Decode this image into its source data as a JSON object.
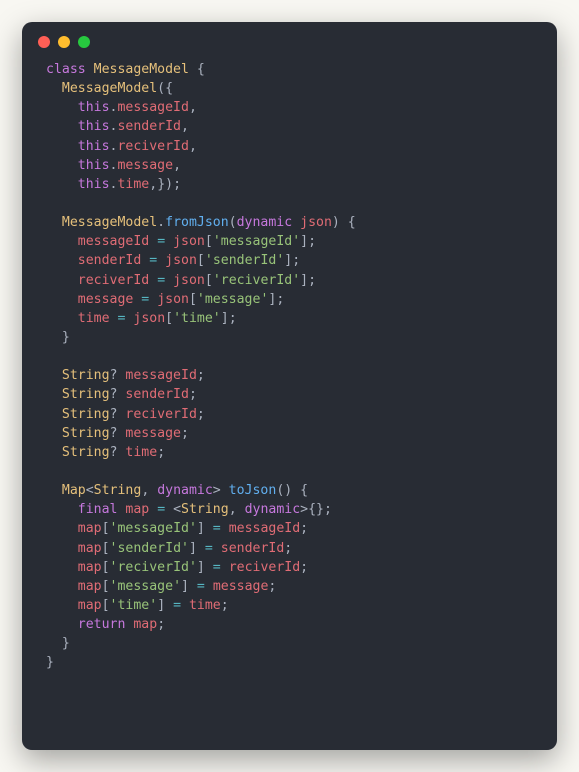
{
  "window": {
    "buttons": [
      "close",
      "minimize",
      "maximize"
    ]
  },
  "code": {
    "lines": [
      [
        [
          "kw",
          "class "
        ],
        [
          "type",
          "MessageModel"
        ],
        [
          "punc",
          " {"
        ]
      ],
      [
        [
          "punc",
          "  "
        ],
        [
          "type",
          "MessageModel"
        ],
        [
          "punc",
          "({"
        ]
      ],
      [
        [
          "punc",
          "    "
        ],
        [
          "kw",
          "this"
        ],
        [
          "punc",
          "."
        ],
        [
          "id",
          "messageId"
        ],
        [
          "punc",
          ","
        ]
      ],
      [
        [
          "punc",
          "    "
        ],
        [
          "kw",
          "this"
        ],
        [
          "punc",
          "."
        ],
        [
          "id",
          "senderId"
        ],
        [
          "punc",
          ","
        ]
      ],
      [
        [
          "punc",
          "    "
        ],
        [
          "kw",
          "this"
        ],
        [
          "punc",
          "."
        ],
        [
          "id",
          "reciverId"
        ],
        [
          "punc",
          ","
        ]
      ],
      [
        [
          "punc",
          "    "
        ],
        [
          "kw",
          "this"
        ],
        [
          "punc",
          "."
        ],
        [
          "id",
          "message"
        ],
        [
          "punc",
          ","
        ]
      ],
      [
        [
          "punc",
          "    "
        ],
        [
          "kw",
          "this"
        ],
        [
          "punc",
          "."
        ],
        [
          "id",
          "time"
        ],
        [
          "punc",
          ",});"
        ]
      ],
      [
        [
          "punc",
          ""
        ]
      ],
      [
        [
          "punc",
          "  "
        ],
        [
          "type",
          "MessageModel"
        ],
        [
          "punc",
          "."
        ],
        [
          "fn",
          "fromJson"
        ],
        [
          "punc",
          "("
        ],
        [
          "kw",
          "dynamic"
        ],
        [
          "punc",
          " "
        ],
        [
          "id",
          "json"
        ],
        [
          "punc",
          ") {"
        ]
      ],
      [
        [
          "punc",
          "    "
        ],
        [
          "id",
          "messageId"
        ],
        [
          "punc",
          " "
        ],
        [
          "op",
          "="
        ],
        [
          "punc",
          " "
        ],
        [
          "id",
          "json"
        ],
        [
          "punc",
          "["
        ],
        [
          "str",
          "'messageId'"
        ],
        [
          "punc",
          "];"
        ]
      ],
      [
        [
          "punc",
          "    "
        ],
        [
          "id",
          "senderId"
        ],
        [
          "punc",
          " "
        ],
        [
          "op",
          "="
        ],
        [
          "punc",
          " "
        ],
        [
          "id",
          "json"
        ],
        [
          "punc",
          "["
        ],
        [
          "str",
          "'senderId'"
        ],
        [
          "punc",
          "];"
        ]
      ],
      [
        [
          "punc",
          "    "
        ],
        [
          "id",
          "reciverId"
        ],
        [
          "punc",
          " "
        ],
        [
          "op",
          "="
        ],
        [
          "punc",
          " "
        ],
        [
          "id",
          "json"
        ],
        [
          "punc",
          "["
        ],
        [
          "str",
          "'reciverId'"
        ],
        [
          "punc",
          "];"
        ]
      ],
      [
        [
          "punc",
          "    "
        ],
        [
          "id",
          "message"
        ],
        [
          "punc",
          " "
        ],
        [
          "op",
          "="
        ],
        [
          "punc",
          " "
        ],
        [
          "id",
          "json"
        ],
        [
          "punc",
          "["
        ],
        [
          "str",
          "'message'"
        ],
        [
          "punc",
          "];"
        ]
      ],
      [
        [
          "punc",
          "    "
        ],
        [
          "id",
          "time"
        ],
        [
          "punc",
          " "
        ],
        [
          "op",
          "="
        ],
        [
          "punc",
          " "
        ],
        [
          "id",
          "json"
        ],
        [
          "punc",
          "["
        ],
        [
          "str",
          "'time'"
        ],
        [
          "punc",
          "];"
        ]
      ],
      [
        [
          "punc",
          "  }"
        ]
      ],
      [
        [
          "punc",
          ""
        ]
      ],
      [
        [
          "punc",
          "  "
        ],
        [
          "type",
          "String"
        ],
        [
          "punc",
          "? "
        ],
        [
          "id",
          "messageId"
        ],
        [
          "punc",
          ";"
        ]
      ],
      [
        [
          "punc",
          "  "
        ],
        [
          "type",
          "String"
        ],
        [
          "punc",
          "? "
        ],
        [
          "id",
          "senderId"
        ],
        [
          "punc",
          ";"
        ]
      ],
      [
        [
          "punc",
          "  "
        ],
        [
          "type",
          "String"
        ],
        [
          "punc",
          "? "
        ],
        [
          "id",
          "reciverId"
        ],
        [
          "punc",
          ";"
        ]
      ],
      [
        [
          "punc",
          "  "
        ],
        [
          "type",
          "String"
        ],
        [
          "punc",
          "? "
        ],
        [
          "id",
          "message"
        ],
        [
          "punc",
          ";"
        ]
      ],
      [
        [
          "punc",
          "  "
        ],
        [
          "type",
          "String"
        ],
        [
          "punc",
          "? "
        ],
        [
          "id",
          "time"
        ],
        [
          "punc",
          ";"
        ]
      ],
      [
        [
          "punc",
          ""
        ]
      ],
      [
        [
          "punc",
          "  "
        ],
        [
          "type",
          "Map"
        ],
        [
          "punc",
          "<"
        ],
        [
          "type",
          "String"
        ],
        [
          "punc",
          ", "
        ],
        [
          "kw",
          "dynamic"
        ],
        [
          "punc",
          "> "
        ],
        [
          "fn",
          "toJson"
        ],
        [
          "punc",
          "() {"
        ]
      ],
      [
        [
          "punc",
          "    "
        ],
        [
          "kw",
          "final"
        ],
        [
          "punc",
          " "
        ],
        [
          "id",
          "map"
        ],
        [
          "punc",
          " "
        ],
        [
          "op",
          "="
        ],
        [
          "punc",
          " <"
        ],
        [
          "type",
          "String"
        ],
        [
          "punc",
          ", "
        ],
        [
          "kw",
          "dynamic"
        ],
        [
          "punc",
          ">{};"
        ]
      ],
      [
        [
          "punc",
          "    "
        ],
        [
          "id",
          "map"
        ],
        [
          "punc",
          "["
        ],
        [
          "str",
          "'messageId'"
        ],
        [
          "punc",
          "] "
        ],
        [
          "op",
          "="
        ],
        [
          "punc",
          " "
        ],
        [
          "id",
          "messageId"
        ],
        [
          "punc",
          ";"
        ]
      ],
      [
        [
          "punc",
          "    "
        ],
        [
          "id",
          "map"
        ],
        [
          "punc",
          "["
        ],
        [
          "str",
          "'senderId'"
        ],
        [
          "punc",
          "] "
        ],
        [
          "op",
          "="
        ],
        [
          "punc",
          " "
        ],
        [
          "id",
          "senderId"
        ],
        [
          "punc",
          ";"
        ]
      ],
      [
        [
          "punc",
          "    "
        ],
        [
          "id",
          "map"
        ],
        [
          "punc",
          "["
        ],
        [
          "str",
          "'reciverId'"
        ],
        [
          "punc",
          "] "
        ],
        [
          "op",
          "="
        ],
        [
          "punc",
          " "
        ],
        [
          "id",
          "reciverId"
        ],
        [
          "punc",
          ";"
        ]
      ],
      [
        [
          "punc",
          "    "
        ],
        [
          "id",
          "map"
        ],
        [
          "punc",
          "["
        ],
        [
          "str",
          "'message'"
        ],
        [
          "punc",
          "] "
        ],
        [
          "op",
          "="
        ],
        [
          "punc",
          " "
        ],
        [
          "id",
          "message"
        ],
        [
          "punc",
          ";"
        ]
      ],
      [
        [
          "punc",
          "    "
        ],
        [
          "id",
          "map"
        ],
        [
          "punc",
          "["
        ],
        [
          "str",
          "'time'"
        ],
        [
          "punc",
          "] "
        ],
        [
          "op",
          "="
        ],
        [
          "punc",
          " "
        ],
        [
          "id",
          "time"
        ],
        [
          "punc",
          ";"
        ]
      ],
      [
        [
          "punc",
          "    "
        ],
        [
          "kw",
          "return"
        ],
        [
          "punc",
          " "
        ],
        [
          "id",
          "map"
        ],
        [
          "punc",
          ";"
        ]
      ],
      [
        [
          "punc",
          "  }"
        ]
      ],
      [
        [
          "punc",
          "}"
        ]
      ]
    ]
  }
}
